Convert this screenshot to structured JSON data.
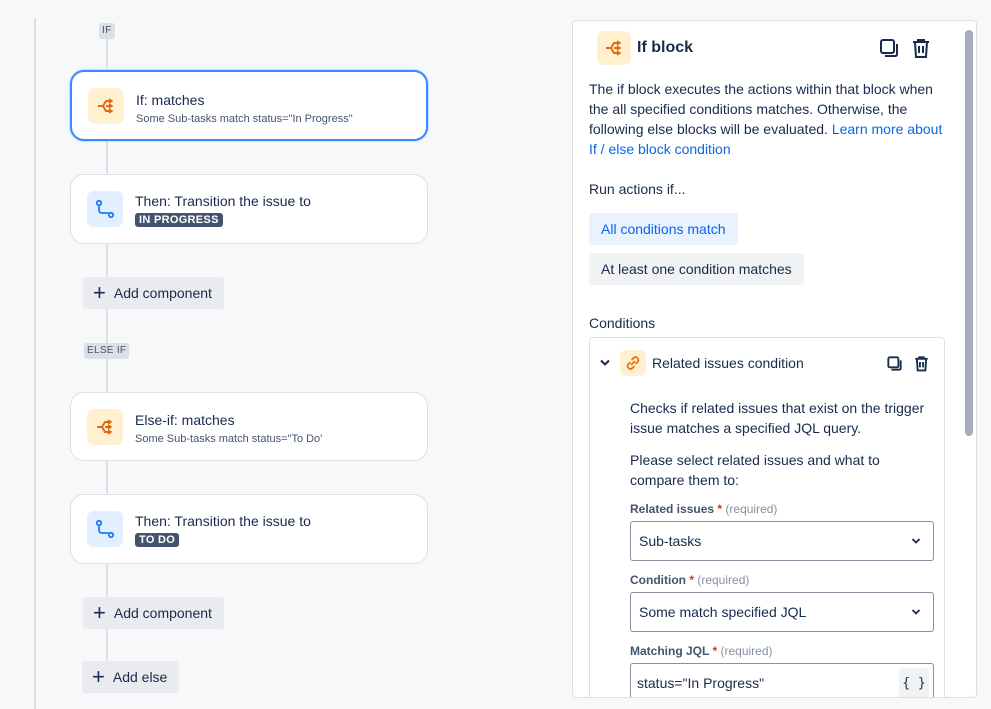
{
  "flow": {
    "if_label": "IF",
    "else_if_label": "ELSE IF",
    "cards": [
      {
        "title": "If: matches",
        "subtitle": "Some Sub-tasks match status=\"In Progress\""
      },
      {
        "title": "Then: Transition the issue to",
        "status": "IN PROGRESS"
      },
      {
        "title": "Else-if: matches",
        "subtitle": "Some Sub-tasks match status=\"To Do'"
      },
      {
        "title": "Then: Transition the issue to",
        "status": "TO DO"
      }
    ],
    "add_component_label": "Add component",
    "add_else_label": "Add else"
  },
  "panel": {
    "title": "If block",
    "description": "The if block executes the actions within that block when the all specified conditions matches. Otherwise, the following else blocks will be evaluated.",
    "learn_more": "Learn more about If / else block condition",
    "run_actions_label": "Run actions if...",
    "options": [
      "All conditions match",
      "At least one condition matches"
    ],
    "selected_option": "All conditions match",
    "conditions_label": "Conditions",
    "condition": {
      "title": "Related issues condition",
      "description": "Checks if related issues that exist on the trigger issue matches a specified JQL query.",
      "instruction": "Please select related issues and what to compare them to:",
      "related_issues_label": "Related issues",
      "condition_label": "Condition",
      "matching_jql_label": "Matching JQL",
      "required_star": "*",
      "required_hint": "(required)",
      "related_issues_value": "Sub-tasks",
      "condition_value": "Some match specified JQL",
      "matching_jql_value": "status=\"In Progress\"",
      "jql_button_label": "{ }"
    }
  },
  "colors": {
    "accent": "#0c66e4",
    "selected_border": "#388bff",
    "orange_icon": "#e56910",
    "blue_icon": "#1d7afc",
    "status_lozenge": "#44546f"
  },
  "icons": [
    "branch-icon",
    "transition-icon",
    "plus-icon",
    "copy-icon",
    "trash-icon",
    "link-icon",
    "chevron-down-icon"
  ]
}
